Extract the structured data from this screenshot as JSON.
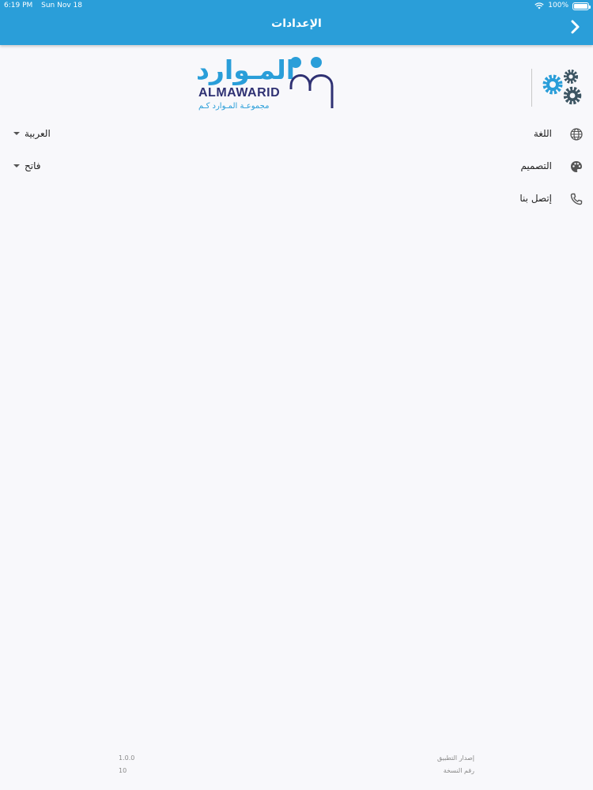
{
  "status_bar": {
    "time": "6:19 PM",
    "date": "Sun Nov 18",
    "battery": "100%",
    "icons": [
      "wifi-icon",
      "battery-icon"
    ]
  },
  "nav": {
    "title": "الإعدادات",
    "back_icon": "chevron-right-icon"
  },
  "brand": {
    "arabic_name": "المـوارد",
    "english_name": "ALMAWARID",
    "tagline": "مجموعـة المـوارد كـم"
  },
  "settings": [
    {
      "label": "اللغة",
      "value": "العربية",
      "icon": "globe-icon",
      "has_dropdown": true
    },
    {
      "label": "التصميم",
      "value": "فاتح",
      "icon": "palette-icon",
      "has_dropdown": true
    },
    {
      "label": "إتصل بنا",
      "value": "",
      "icon": "phone-icon",
      "has_dropdown": false
    }
  ],
  "footer": {
    "app_version_label": "إصدار التطبيق",
    "app_version": "1.0.0",
    "build_label": "رقم النسخة",
    "build": "10"
  },
  "colors": {
    "primary": "#2a9ed9",
    "brand_dark": "#2f3173",
    "gear_blue": "#2a9ed9",
    "gear_dark": "#3d5563",
    "background": "#f8f8fb"
  }
}
